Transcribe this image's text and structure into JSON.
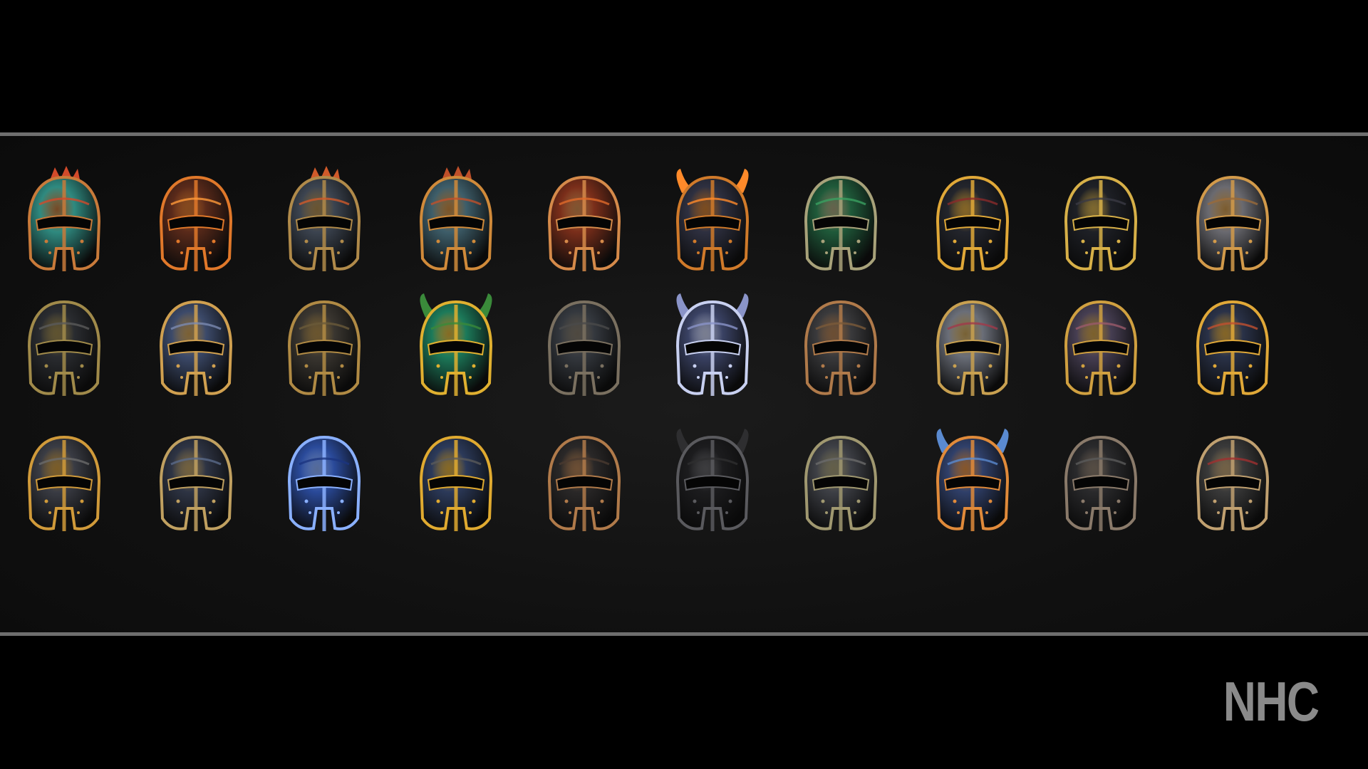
{
  "watermark": {
    "text": "NHC"
  },
  "gallery": {
    "rows": [
      [
        {
          "name": "teal-spiked-helmet-icon",
          "base": "#2f8a80",
          "trim": "#c87a3a",
          "accent": "#d24a2a"
        },
        {
          "name": "flame-helmet-icon",
          "base": "#5a2a1a",
          "trim": "#e0782a",
          "accent": "#ff9a3a"
        },
        {
          "name": "crested-steel-helmet-icon",
          "base": "#3c4450",
          "trim": "#b08a4a",
          "accent": "#d05a2a"
        },
        {
          "name": "ornate-teal-helmet-icon",
          "base": "#3e5e6a",
          "trim": "#d08a3a",
          "accent": "#c0502a"
        },
        {
          "name": "red-filigree-helmet-icon",
          "base": "#7a2e1a",
          "trim": "#d58a4a",
          "accent": "#e06a2a"
        },
        {
          "name": "horned-demon-helmet-icon",
          "base": "#2e3040",
          "trim": "#d07a2a",
          "accent": "#ff8a2a"
        },
        {
          "name": "green-leaf-helmet-icon",
          "base": "#1f5a3a",
          "trim": "#a8a27a",
          "accent": "#3aa060"
        },
        {
          "name": "gold-black-helmet-icon",
          "base": "#23252c",
          "trim": "#e0a838",
          "accent": "#8a2a2a"
        },
        {
          "name": "black-gold-visor-helmet-icon",
          "base": "#1e2026",
          "trim": "#d7b048",
          "accent": "#3a3a44"
        },
        {
          "name": "bronze-crested-helmet-icon",
          "base": "#6a6a70",
          "trim": "#d29a4a",
          "accent": "#9a6a3a"
        }
      ],
      [
        {
          "name": "spartan-dark-helmet-icon",
          "base": "#2a2c30",
          "trim": "#a08a4a",
          "accent": "#5a5a5a"
        },
        {
          "name": "blue-crown-helmet-icon",
          "base": "#3c4a6a",
          "trim": "#d0a050",
          "accent": "#7a8ab0"
        },
        {
          "name": "bronze-bucket-helmet-icon",
          "base": "#3a3630",
          "trim": "#b08a44",
          "accent": "#6a5a3a"
        },
        {
          "name": "green-horned-helmet-icon",
          "base": "#1c7a5a",
          "trim": "#e0b030",
          "accent": "#3a8a3a"
        },
        {
          "name": "great-helm-icon",
          "base": "#34383e",
          "trim": "#7a7060",
          "accent": "#4a4a4a"
        },
        {
          "name": "silver-blue-mask-helmet-icon",
          "base": "#3a4264",
          "trim": "#c8d0f0",
          "accent": "#8a94c8"
        },
        {
          "name": "centurion-helmet-icon",
          "base": "#3a3a3c",
          "trim": "#b07a4a",
          "accent": "#7a5a3a"
        },
        {
          "name": "riveted-silver-helmet-icon",
          "base": "#6a6e78",
          "trim": "#c8a050",
          "accent": "#a03a4a"
        },
        {
          "name": "purple-gold-helmet-icon",
          "base": "#463e52",
          "trim": "#d0a040",
          "accent": "#9a5a6a"
        },
        {
          "name": "royal-blue-gold-helmet-icon",
          "base": "#2a3248",
          "trim": "#e0a838",
          "accent": "#c05030"
        }
      ],
      [
        {
          "name": "small-steel-helmet-icon",
          "base": "#3a3c44",
          "trim": "#d09a3a",
          "accent": "#6a6a6a"
        },
        {
          "name": "navy-visor-helmet-icon",
          "base": "#2e3444",
          "trim": "#c0a060",
          "accent": "#5a6a8a"
        },
        {
          "name": "cobalt-helmet-icon",
          "base": "#2a4a9a",
          "trim": "#8ab0ff",
          "accent": "#1c3480"
        },
        {
          "name": "blue-gold-bascinet-icon",
          "base": "#2c3a5a",
          "trim": "#e0aa30",
          "accent": "#5a5a5a"
        },
        {
          "name": "black-bronze-helmet-icon",
          "base": "#2a2828",
          "trim": "#b07a4a",
          "accent": "#4a3a30"
        },
        {
          "name": "shadow-helmet-icon",
          "base": "#1c1c1e",
          "trim": "#5a5a5e",
          "accent": "#2e2e30"
        },
        {
          "name": "kettle-helmet-icon",
          "base": "#3e4046",
          "trim": "#a09870",
          "accent": "#6a6a6a"
        },
        {
          "name": "winged-blue-helmet-icon",
          "base": "#30406a",
          "trim": "#e08a3a",
          "accent": "#5a8ad0"
        },
        {
          "name": "plumed-dark-helmet-icon",
          "base": "#2a2a2c",
          "trim": "#8a7a6a",
          "accent": "#5a5a5a"
        },
        {
          "name": "red-crest-helmet-icon",
          "base": "#3a3a3a",
          "trim": "#c0a070",
          "accent": "#a03030"
        }
      ]
    ]
  }
}
